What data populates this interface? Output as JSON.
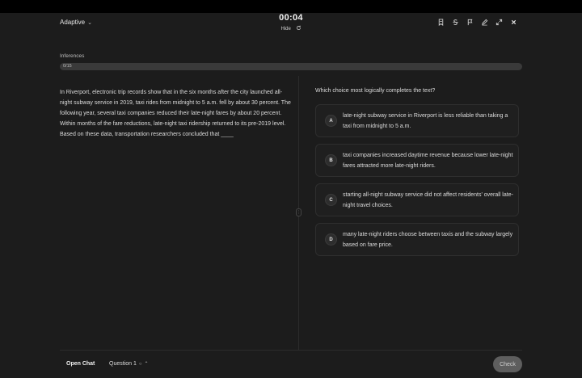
{
  "header": {
    "mode_label": "Adaptive",
    "timer": "00:04",
    "hide_label": "Hide"
  },
  "section": {
    "title": "Inferences",
    "progress_text": "0/15",
    "progress_fraction": 0
  },
  "passage": {
    "text": "In Riverport, electronic trip records show that in the six months after the city launched all-night subway service in 2019, taxi rides from midnight to 5 a.m. fell by about 30 percent. The following year, several taxi companies reduced their late-night fares by about 20 percent. Within months of the fare reductions, late-night taxi ridership returned to its pre-2019 level. Based on these data, transportation researchers concluded that ____"
  },
  "question": {
    "prompt": "Which choice most logically completes the text?",
    "choices": [
      {
        "letter": "A",
        "text": "late-night subway service in Riverport is less reliable than taking a taxi from midnight to 5 a.m."
      },
      {
        "letter": "B",
        "text": "taxi companies increased daytime revenue because lower late-night fares attracted more late-night riders."
      },
      {
        "letter": "C",
        "text": "starting all-night subway service did not affect residents' overall late-night travel choices."
      },
      {
        "letter": "D",
        "text": "many late-night riders choose between taxis and the subway largely based on fare price."
      }
    ]
  },
  "footer": {
    "open_chat_label": "Open Chat",
    "question_nav_label": "Question 1",
    "check_label": "Check"
  }
}
